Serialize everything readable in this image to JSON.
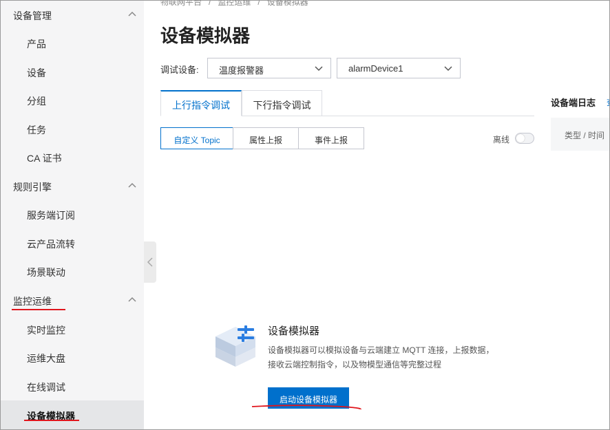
{
  "sidebar": {
    "groups": [
      {
        "label": "设备管理",
        "items": [
          "产品",
          "设备",
          "分组",
          "任务",
          "CA 证书"
        ]
      },
      {
        "label": "规则引擎",
        "items": [
          "服务端订阅",
          "云产品流转",
          "场景联动"
        ]
      },
      {
        "label": "监控运维",
        "items": [
          "实时监控",
          "运维大盘",
          "在线调试",
          "设备模拟器"
        ]
      }
    ]
  },
  "breadcrumb": [
    "物联网平台",
    "监控运维",
    "设备模拟器"
  ],
  "page": {
    "title": "设备模拟器"
  },
  "device_select": {
    "label": "调试设备:",
    "product_value": "温度报警器",
    "device_value": "alarmDevice1"
  },
  "tabs": [
    "上行指令调试",
    "下行指令调试"
  ],
  "segments": [
    "自定义 Topic",
    "属性上报",
    "事件上报"
  ],
  "offline_label": "离线",
  "log_panel": {
    "title": "设备端日志",
    "more": "查",
    "column": "类型 / 时间"
  },
  "empty_state": {
    "title": "设备模拟器",
    "description": "设备模拟器可以模拟设备与云端建立 MQTT 连接，上报数据，接收云端控制指令，以及物模型通信等完整过程",
    "button": "启动设备模拟器"
  },
  "colors": {
    "accent": "#0070cc",
    "annotation_red": "#e0151c"
  }
}
